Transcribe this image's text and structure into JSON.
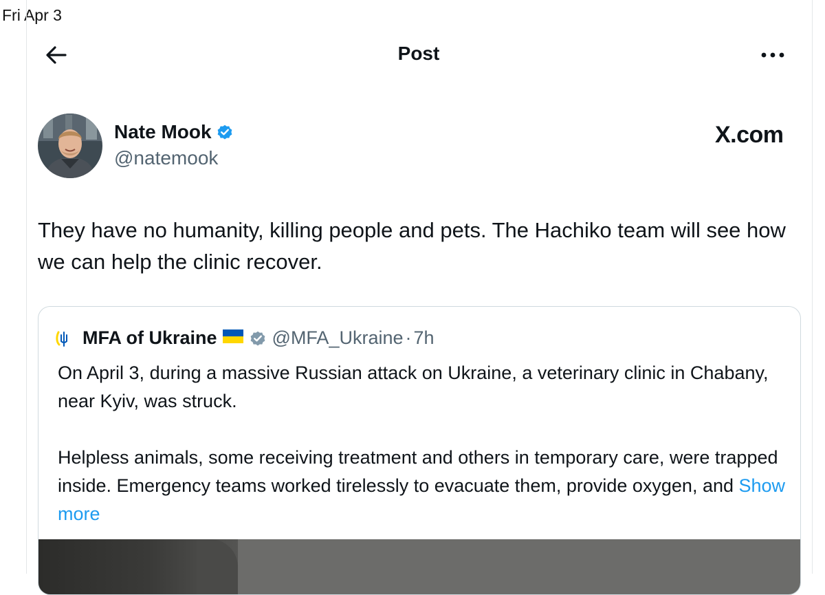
{
  "status_bar": {
    "date": "Fri Apr 3"
  },
  "header": {
    "title": "Post"
  },
  "author": {
    "name": "Nate Mook",
    "handle": "@natemook",
    "verified": true
  },
  "site_label": "X.com",
  "post": {
    "text": "They have no humanity, killing people and pets. The Hachiko team will see how we can help the clinic recover."
  },
  "quoted_post": {
    "name": "MFA of Ukraine",
    "handle": "@MFA_Ukraine",
    "separator": "·",
    "time": "7h",
    "verified_badge": "gray",
    "paragraph_1": "On April 3, during a massive Russian attack on Ukraine, a veterinary clinic in Chabany, near Kyiv, was struck.",
    "paragraph_2": "Helpless animals, some receiving treatment and others in temporary care, were trapped inside. Emergency teams worked tirelessly to evacuate them, provide oxygen, and",
    "show_more": "Show more"
  },
  "colors": {
    "accent": "#1d9bf0",
    "text": "#0f1419",
    "secondary": "#536471",
    "border": "#cfd9de",
    "flag_blue": "#0057b7",
    "flag_yellow": "#ffd700"
  },
  "icons": [
    "back-arrow-icon",
    "more-dots-icon",
    "verified-badge-icon",
    "ukraine-emblem-icon",
    "ukraine-flag-icon",
    "gray-verified-badge-icon"
  ]
}
